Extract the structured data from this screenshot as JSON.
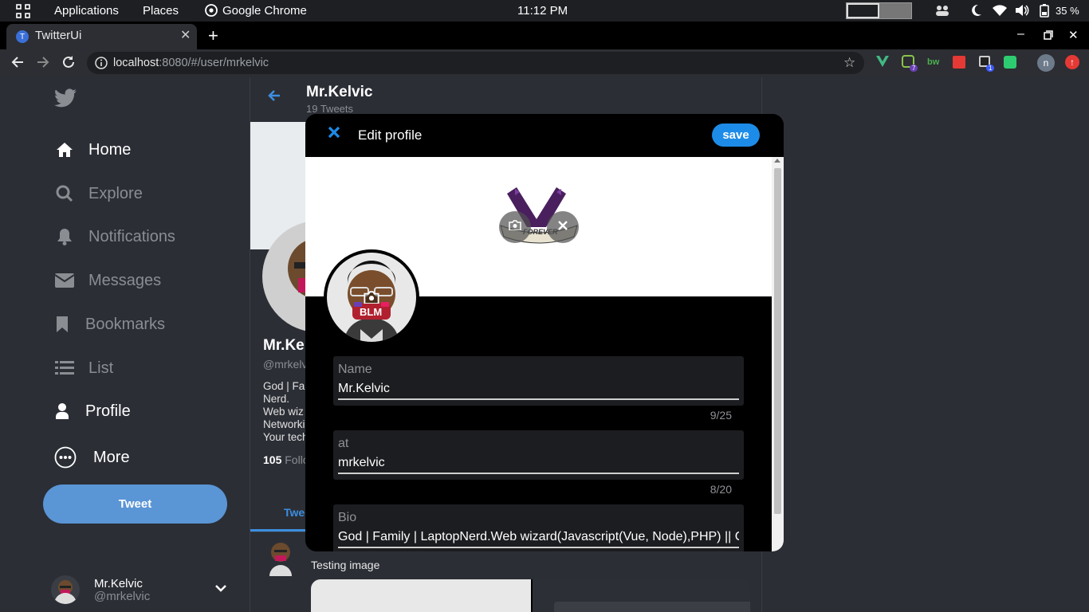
{
  "system_bar": {
    "applications": "Applications",
    "places": "Places",
    "active_app": "Google Chrome",
    "clock": "11:12 PM",
    "battery": "35 %"
  },
  "browser": {
    "tab_title": "TwitterUi",
    "tab_favicon_letter": "T",
    "url_host": "localhost",
    "url_rest": ":8080/#/user/mrkelvic",
    "profile_letter": "n",
    "ext_badge_1": "7",
    "ext_badge_2": "1",
    "ext_bw_label": "bw"
  },
  "sidebar": {
    "items": [
      {
        "label": "Home",
        "icon": "home-icon"
      },
      {
        "label": "Explore",
        "icon": "search-icon"
      },
      {
        "label": "Notifications",
        "icon": "bell-icon"
      },
      {
        "label": "Messages",
        "icon": "mail-icon"
      },
      {
        "label": "Bookmarks",
        "icon": "bookmark-icon"
      },
      {
        "label": "List",
        "icon": "list-icon"
      },
      {
        "label": "Profile",
        "icon": "user-icon"
      },
      {
        "label": "More",
        "icon": "more-icon"
      }
    ],
    "tweet_button": "Tweet",
    "account_name": "Mr.Kelvic",
    "account_handle": "@mrkelvic"
  },
  "profile_page": {
    "name": "Mr.Kelvic",
    "tweet_count": "19 Tweets",
    "name_partial": "Mr.Ke",
    "handle_partial": "@mrkelv",
    "bio_lines": [
      "God | Fa",
      "Nerd.",
      "Web wiz",
      "Networki",
      "Your tech"
    ],
    "followers_count": "105",
    "followers_label": "Follo",
    "tab_tweets": "Twee",
    "tweet_text": "Testing image"
  },
  "modal": {
    "title": "Edit profile",
    "save_label": "save",
    "banner_text": "FOREVER",
    "avatar_text": "BLM",
    "fields": [
      {
        "label": "Name",
        "value": "Mr.Kelvic",
        "counter": "9/25"
      },
      {
        "label": "at",
        "value": "mrkelvic",
        "counter": "8/20"
      },
      {
        "label": "Bio",
        "value": "God | Family | LaptopNerd.Web wizard(Javascript(Vue, Node),PHP) || C"
      }
    ]
  },
  "colors": {
    "accent": "#1d8ce8",
    "tweet_button": "#5a95d6",
    "background": "#2b2e35"
  }
}
